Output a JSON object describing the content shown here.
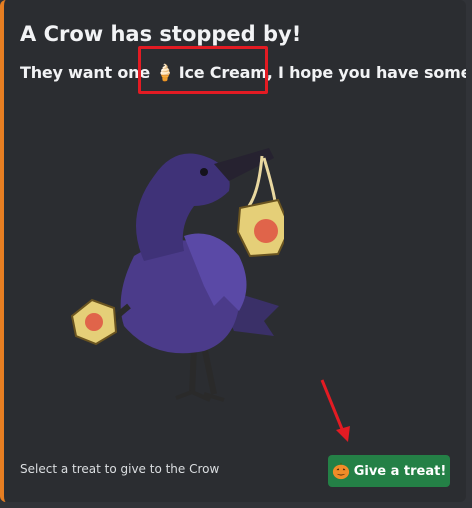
{
  "embed": {
    "accent_color": "#e67e22",
    "title": "A Crow has stopped by!",
    "desc_before": "They want one ",
    "desc_emoji": "🍦",
    "desc_item": " Ice Cream,",
    "desc_after": " I hope you have some!",
    "image_icon": "crow-holding-pumpkin-bags-image",
    "footer": "Select a treat to give to the Crow"
  },
  "button": {
    "icon": "pumpkin-icon",
    "label": "Give a treat!",
    "color": "#248046"
  },
  "annotations": {
    "highlight_color": "#e31b23"
  }
}
